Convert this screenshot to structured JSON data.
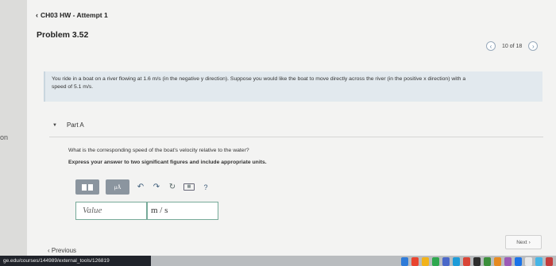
{
  "breadcrumb": {
    "back_icon": "chevron-left-icon",
    "label": "CH03 HW - Attempt 1"
  },
  "problem": {
    "title": "Problem 3.52",
    "text_line1": "You ride in a boat on a river flowing at 1.6 m/s (in the negative y direction). Suppose you would like the boat to move directly across the river (in the positive x direction) with a",
    "text_line2": "speed of 5.1 m/s."
  },
  "pager": {
    "label": "10 of 18",
    "prev_icon": "chevron-left-icon",
    "next_icon": "chevron-right-icon"
  },
  "part": {
    "label": "Part A",
    "question": "What is the corresponding speed of the boat's velocity relative to the water?",
    "instruction": "Express your answer to two significant figures and include appropriate units."
  },
  "toolbar": {
    "templates_icon": "templates-icon",
    "symbols_label": "μÅ",
    "undo_icon": "undo-icon",
    "redo_icon": "redo-icon",
    "reset_icon": "reset-icon",
    "keyboard_icon": "keyboard-icon",
    "help_label": "?"
  },
  "answer": {
    "value_placeholder": "Value",
    "units_value": "m / s"
  },
  "nav": {
    "next_label": "Next",
    "previous_label": "Previous"
  },
  "left_gutter": {
    "text": "on"
  },
  "status_bar": {
    "url": "ge.edu/courses/144989/external_tools/126819"
  },
  "colors": {
    "problem_bg": "#e2e9ee",
    "toolbar_btn": "#8b959f",
    "status_bar": "#20232a"
  }
}
